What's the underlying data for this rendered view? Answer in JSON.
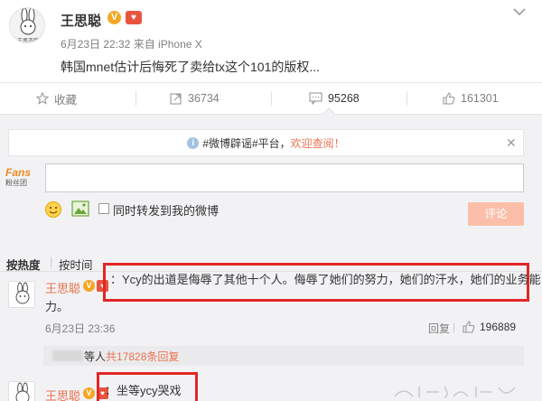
{
  "post": {
    "author": "王思聪",
    "v_badge": "V",
    "level_badge": "♥",
    "avatar_caption": "王思不胖",
    "meta": "6月23日 22:32 来自 iPhone X",
    "text": "韩国mnet估计后悔死了卖给tx这个101的版权..."
  },
  "actions": {
    "favorite": "收藏",
    "repost_count": "36734",
    "comment_count": "95268",
    "like_count": "161301"
  },
  "notice": {
    "prefix": "#微博辟谣#平台，",
    "highlight": "欢迎查阅！",
    "close": "✕"
  },
  "composer": {
    "fans_logo_top": "Fans",
    "fans_logo_bottom": "粉丝团",
    "input_value": "",
    "repost_label": "同时转发到我的微博",
    "submit_label": "评论"
  },
  "sort": {
    "hot": "按热度",
    "separator": "|",
    "time": "按时间"
  },
  "comments": [
    {
      "author": "王思聪",
      "text_line1": "：Ycy的出道是侮辱了其他十个人。侮辱了她们的努力，她们的汗水，她们的业务能",
      "text_line2": "力。",
      "time": "6月23日 23:36",
      "reply_label": "回复",
      "likes": "196889",
      "sub_replies_tail": "等人",
      "sub_replies_link": "共17828条回复"
    },
    {
      "author": "王思聪",
      "text": "：坐等ycy哭戏"
    }
  ],
  "colors": {
    "accent": "#eb7350",
    "highlight_box": "#e32626",
    "comment_bg": "#f2f2f5"
  }
}
